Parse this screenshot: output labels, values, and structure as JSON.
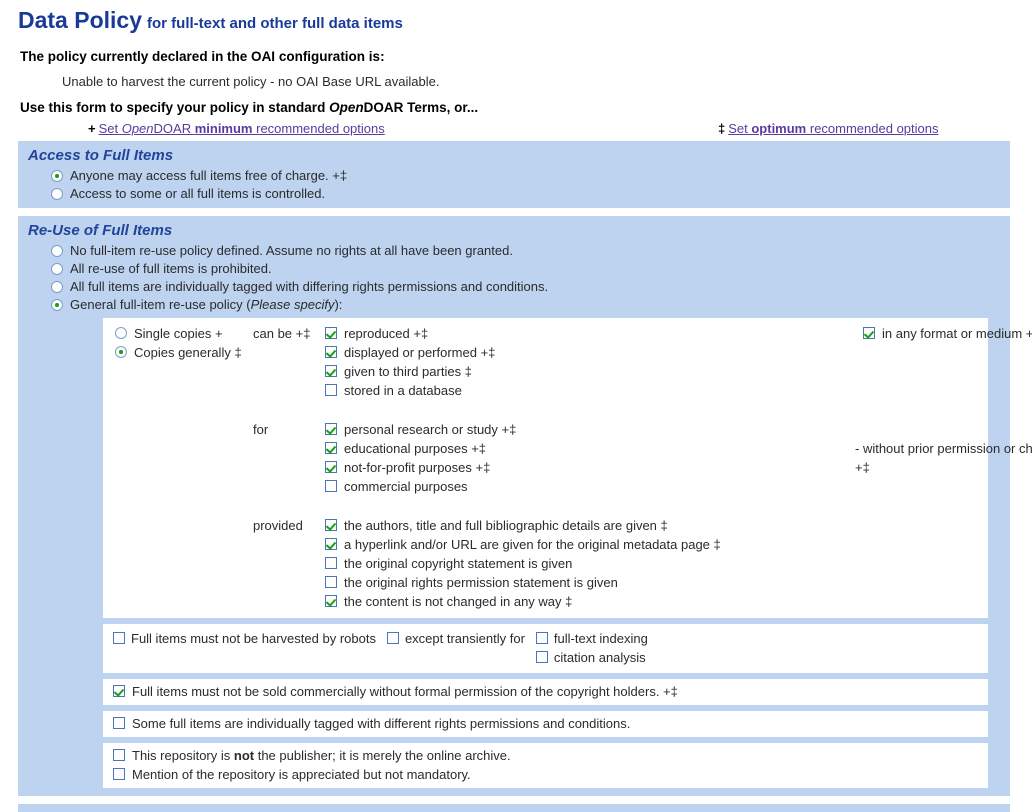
{
  "header": {
    "title_main": "Data Policy",
    "title_sub": "for full-text and other full data items",
    "declared_label": "The policy currently declared in the OAI configuration is:",
    "declared_status": "Unable to harvest the current policy - no OAI Base URL available.",
    "form_intro_a": "Use this form to specify your policy in standard ",
    "form_intro_em": "Open",
    "form_intro_b": "DOAR Terms, or...",
    "link_min": {
      "marker": "+",
      "a": "Set ",
      "em": "Open",
      "b": "DOAR ",
      "bold": "minimum",
      "c": " recommended options"
    },
    "link_opt": {
      "marker": "‡",
      "a": "Set ",
      "bold": "optimum",
      "c": " recommended options"
    }
  },
  "access_section": {
    "title": "Access to Full Items",
    "options": [
      {
        "label": "Anyone may access full items free of charge. +‡",
        "checked": true
      },
      {
        "label": "Access to some or all full items is controlled.",
        "checked": false
      }
    ]
  },
  "reuse_section": {
    "title": "Re-Use of Full Items",
    "options": [
      {
        "label": "No full-item re-use policy defined. Assume no rights at all have been granted.",
        "checked": false
      },
      {
        "label": "All re-use of full items is prohibited.",
        "checked": false
      },
      {
        "label": "All full items are individually tagged with differing rights permissions and conditions.",
        "checked": false
      },
      {
        "label_a": "General full-item re-use policy (",
        "label_em": "Please specify",
        "label_b": "):",
        "checked": true
      }
    ],
    "copies": {
      "options": [
        {
          "label": "Single copies +",
          "checked": false
        },
        {
          "label": "Copies generally ‡",
          "checked": true
        }
      ]
    },
    "connectors": {
      "can_be": "can be +‡",
      "for": "for",
      "provided": "provided"
    },
    "can_be_items": [
      {
        "label": "reproduced +‡",
        "checked": true
      },
      {
        "label": "displayed or performed +‡",
        "checked": true
      },
      {
        "label": "given to third parties ‡",
        "checked": true
      },
      {
        "label": "stored in a database",
        "checked": false
      }
    ],
    "format_item": {
      "label": "in any format or medium +‡",
      "checked": true
    },
    "for_items": [
      {
        "label": "personal research or study +‡",
        "checked": true
      },
      {
        "label": "educational purposes +‡",
        "checked": true
      },
      {
        "label": "not-for-profit purposes +‡",
        "checked": true
      },
      {
        "label": "commercial purposes",
        "checked": false
      }
    ],
    "for_note_line1": "- without prior permission or charge",
    "for_note_line2": "+‡",
    "provided_items": [
      {
        "label": "the authors, title and full bibliographic details are given ‡",
        "checked": true
      },
      {
        "label": "a hyperlink and/or URL are given for the original metadata page ‡",
        "checked": true
      },
      {
        "label": "the original copyright statement is given",
        "checked": false
      },
      {
        "label": "the original rights permission statement is given",
        "checked": false
      },
      {
        "label": "the content is not changed in any way ‡",
        "checked": true
      }
    ],
    "robots": {
      "main": {
        "label": "Full items must not be harvested by robots",
        "checked": false
      },
      "except": {
        "label": "except transiently for",
        "checked": false
      },
      "sub": [
        {
          "label": "full-text indexing",
          "checked": false
        },
        {
          "label": "citation analysis",
          "checked": false
        }
      ]
    },
    "commercial_sale": {
      "label": "Full items must not be sold commercially without formal permission of the copyright holders. +‡",
      "checked": true
    },
    "tagged_items": {
      "label": "Some full items are individually tagged with different rights permissions and conditions.",
      "checked": false
    },
    "publisher_notes": [
      {
        "label_a": "This repository is ",
        "label_bold": "not",
        "label_b": " the publisher; it is merely the online archive.",
        "checked": false
      },
      {
        "label_a": "Mention of the repository is appreciated but not mandatory.",
        "label_bold": "",
        "label_b": "",
        "checked": false
      }
    ]
  },
  "colors": {
    "panel_blue": "#bdd3ef",
    "heading_blue": "#22449b",
    "title_blue": "#1a3a99",
    "link_purple": "#5b3a9e",
    "check_green": "#17a017"
  }
}
